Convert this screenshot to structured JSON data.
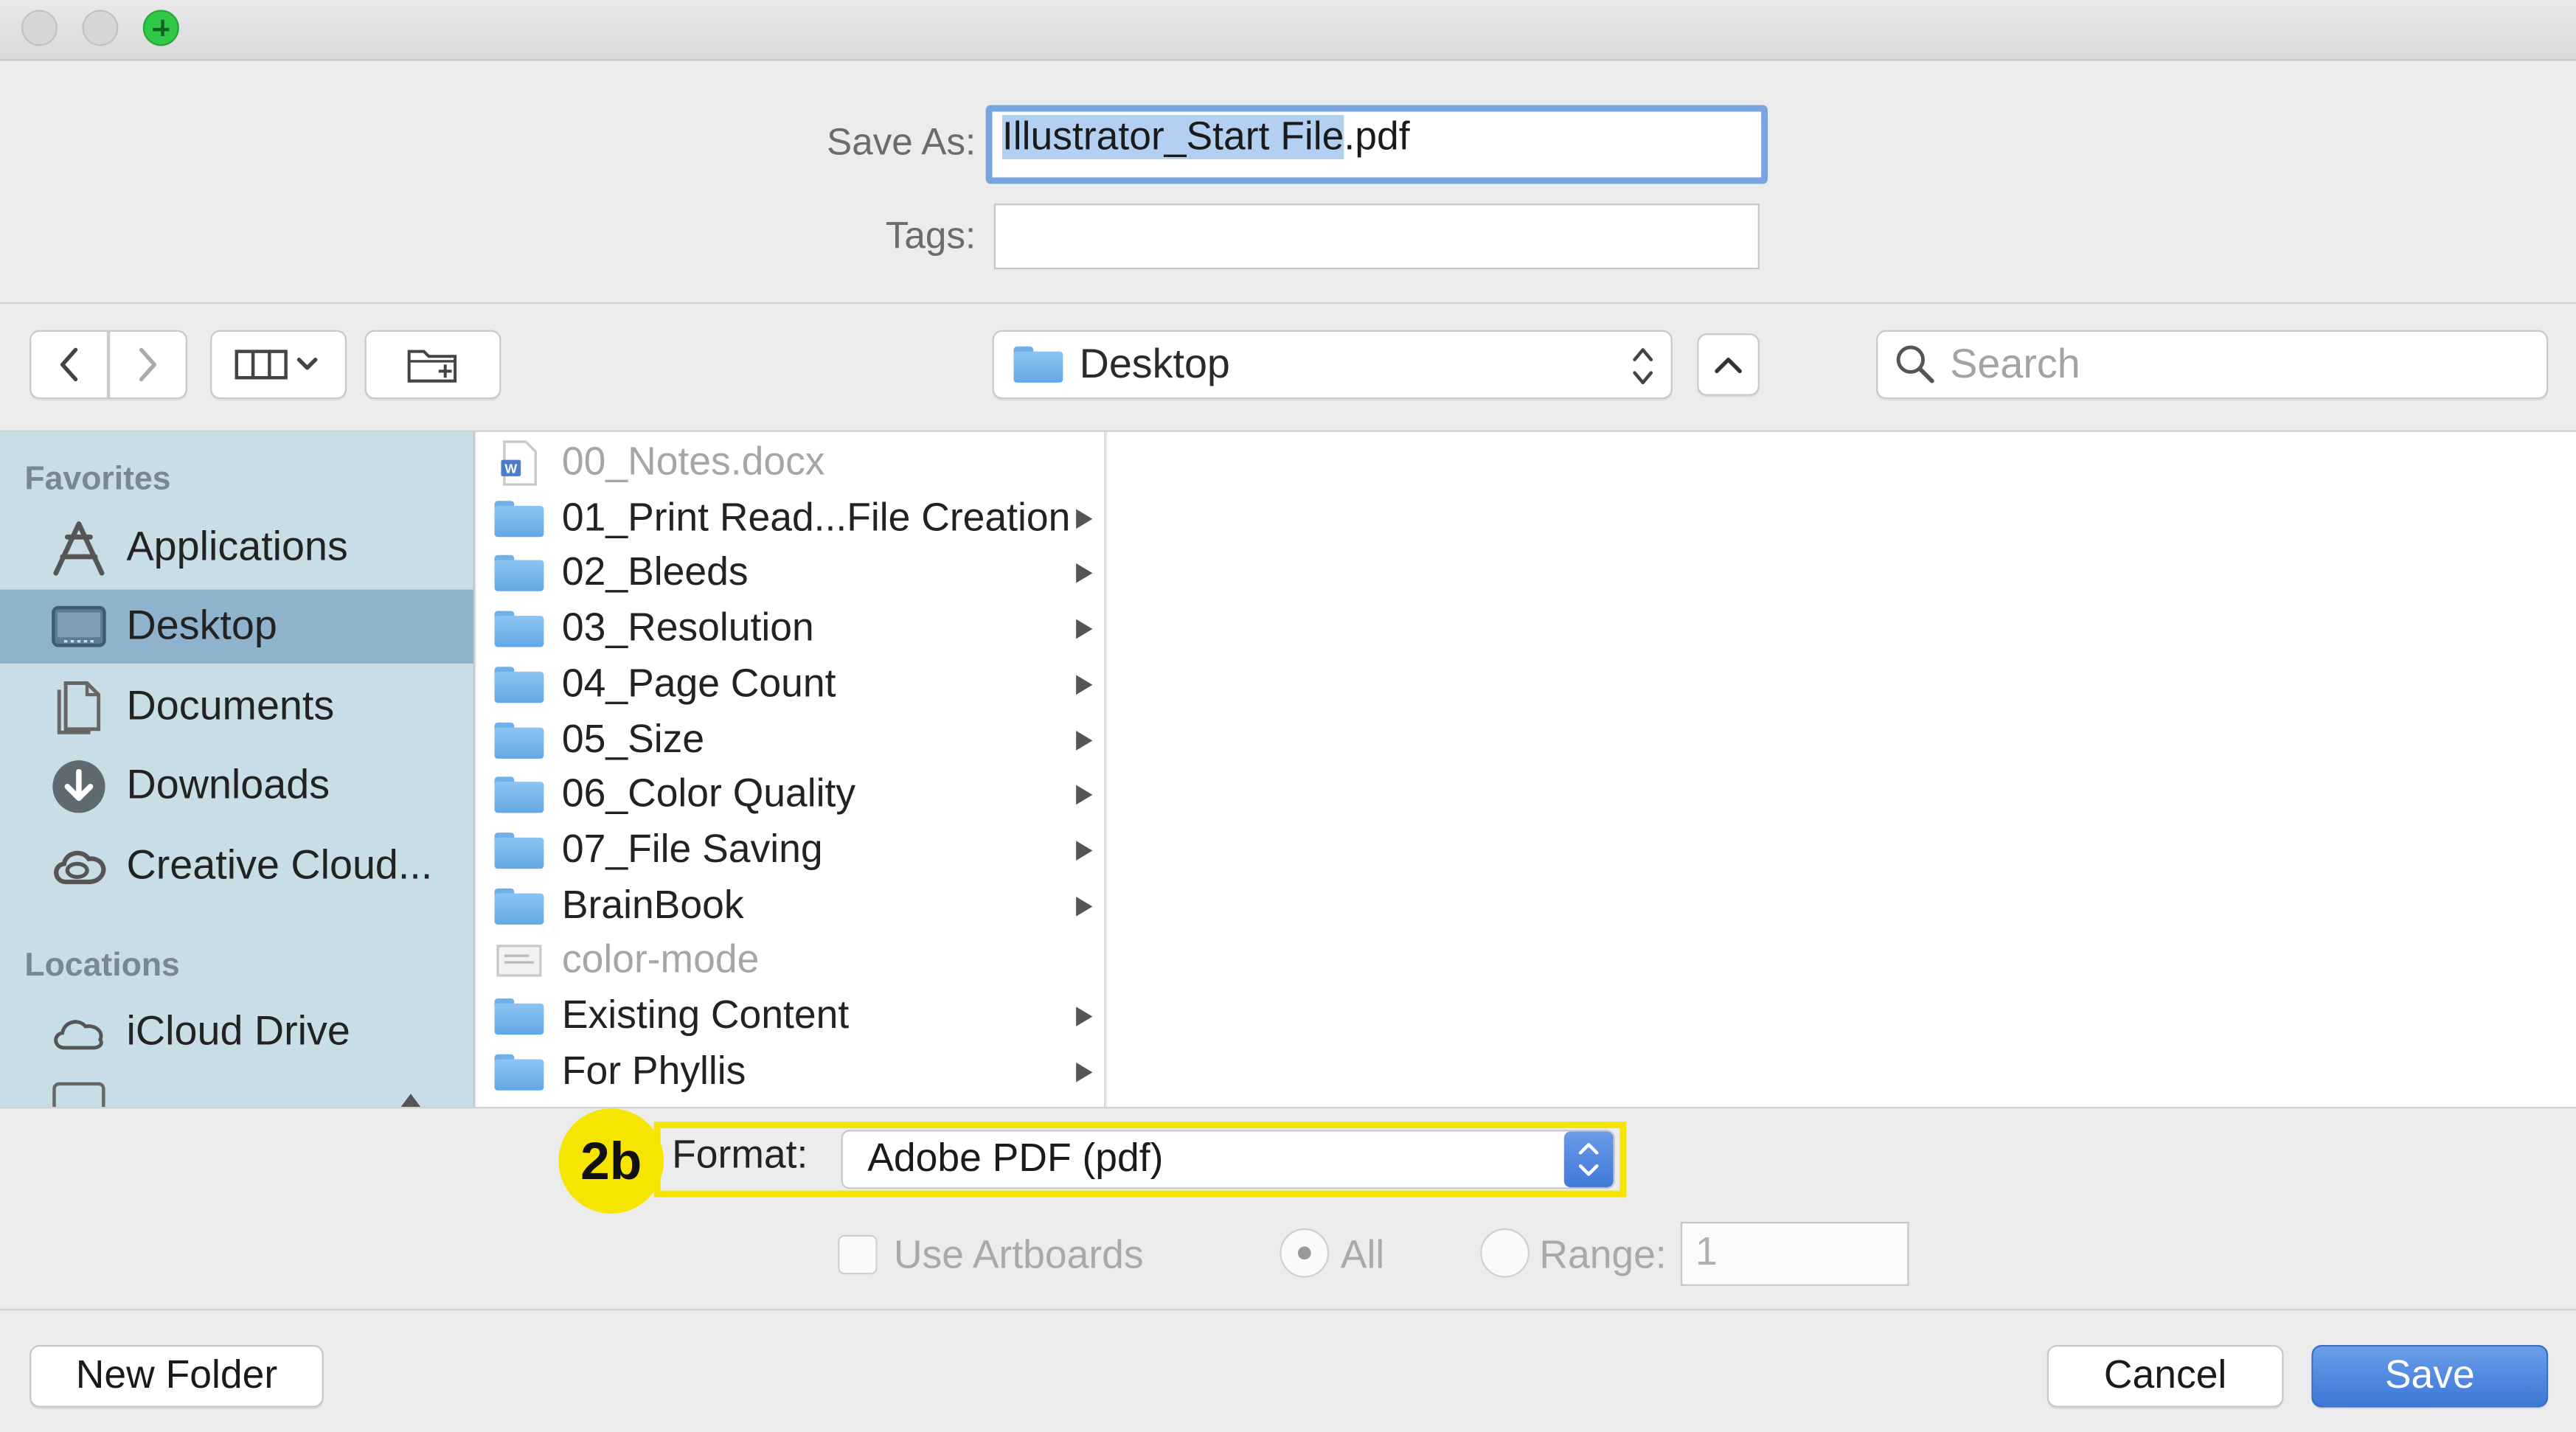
{
  "save_as": {
    "label": "Save As:",
    "selected_text": "Illustrator_Start File",
    "extension": ".pdf",
    "tags_label": "Tags:",
    "tags_value": ""
  },
  "toolbar": {
    "location": "Desktop",
    "search_placeholder": "Search"
  },
  "sidebar": {
    "favorites_heading": "Favorites",
    "items": [
      {
        "label": "Applications",
        "icon": "applications-icon"
      },
      {
        "label": "Desktop",
        "icon": "desktop-icon",
        "selected": true
      },
      {
        "label": "Documents",
        "icon": "documents-icon"
      },
      {
        "label": "Downloads",
        "icon": "downloads-icon"
      },
      {
        "label": "Creative Cloud...",
        "icon": "creative-cloud-icon"
      }
    ],
    "locations_heading": "Locations",
    "locations": [
      {
        "label": "iCloud Drive",
        "icon": "cloud-icon"
      }
    ]
  },
  "files": [
    {
      "name": "00_Notes.docx",
      "type": "doc",
      "dim": true
    },
    {
      "name": "01_Print Read...File Creation",
      "type": "folder"
    },
    {
      "name": "02_Bleeds",
      "type": "folder"
    },
    {
      "name": "03_Resolution",
      "type": "folder"
    },
    {
      "name": "04_Page Count",
      "type": "folder"
    },
    {
      "name": "05_Size",
      "type": "folder"
    },
    {
      "name": "06_Color Quality",
      "type": "folder"
    },
    {
      "name": "07_File Saving",
      "type": "folder"
    },
    {
      "name": "BrainBook",
      "type": "folder"
    },
    {
      "name": "color-mode",
      "type": "image",
      "dim": true
    },
    {
      "name": "Existing Content",
      "type": "folder"
    },
    {
      "name": "For Phyllis",
      "type": "folder"
    }
  ],
  "format": {
    "callout": "2b",
    "label": "Format:",
    "value": "Adobe PDF (pdf)",
    "highlight_color": "#f6e500"
  },
  "artboards": {
    "use_label": "Use Artboards",
    "all_label": "All",
    "range_label": "Range:",
    "range_value": "1"
  },
  "buttons": {
    "new_folder": "New Folder",
    "cancel": "Cancel",
    "save": "Save"
  },
  "colors": {
    "accent": "#3d77d7",
    "sidebar_bg": "#c9dde6",
    "sidebar_selected": "#8fb3cd",
    "folder_blue": "#6fb0e8"
  }
}
